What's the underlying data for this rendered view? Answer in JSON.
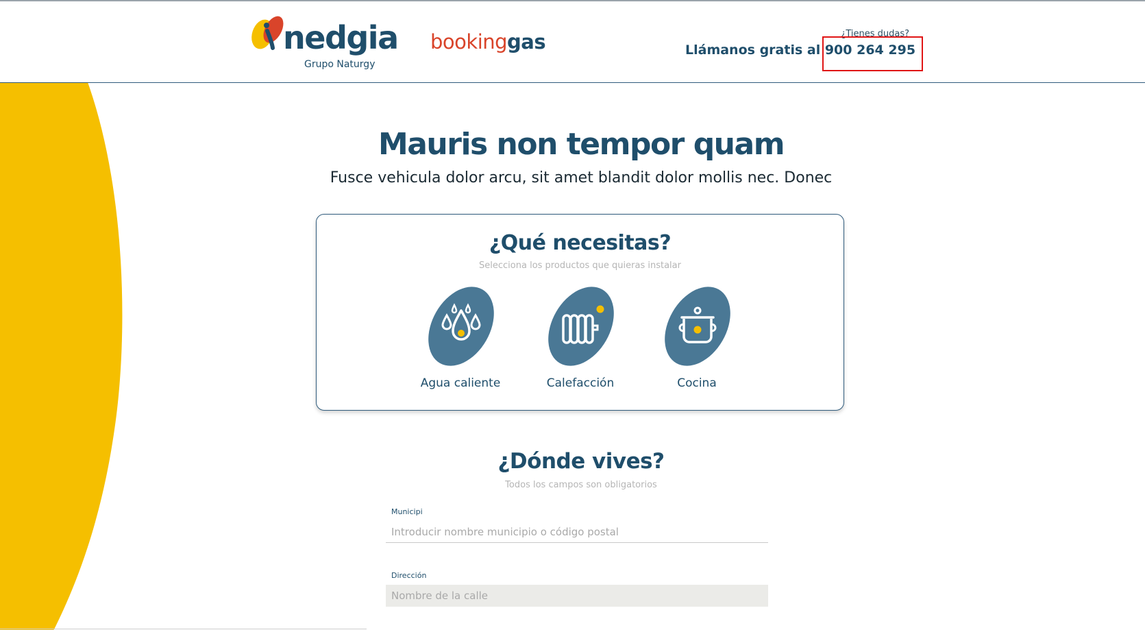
{
  "header": {
    "logo_name": "nedgia",
    "logo_subtitle": "Grupo Naturgy",
    "brand_booking": "booking",
    "brand_gas": "gas",
    "help_question": "¿Tienes dudas?",
    "help_call_text": "Llámanos gratis al ",
    "help_phone": "900 264 295"
  },
  "hero": {
    "title": "Mauris non tempor quam",
    "subtitle": "Fusce vehicula dolor arcu, sit amet blandit dolor mollis nec. Donec"
  },
  "needs": {
    "title": "¿Qué necesitas?",
    "subtitle": "Selecciona los productos que quieras instalar",
    "products": [
      {
        "label": "Agua caliente",
        "icon": "water-drops-icon"
      },
      {
        "label": "Calefacción",
        "icon": "radiator-icon"
      },
      {
        "label": "Cocina",
        "icon": "cooking-pot-icon"
      }
    ]
  },
  "location": {
    "title": "¿Dónde vives?",
    "subtitle": "Todos los campos son obligatorios",
    "municipio_label": "Municipi",
    "municipio_placeholder": "Introducir nombre municipio o código postal",
    "direccion_label": "Dirección",
    "direccion_placeholder": "Nombre de la calle"
  },
  "colors": {
    "brand_navy": "#1f4e6b",
    "brand_red": "#d9442a",
    "accent_yellow": "#f5bf00",
    "icon_blue": "#4a7895",
    "highlight_box": "#e01515"
  }
}
